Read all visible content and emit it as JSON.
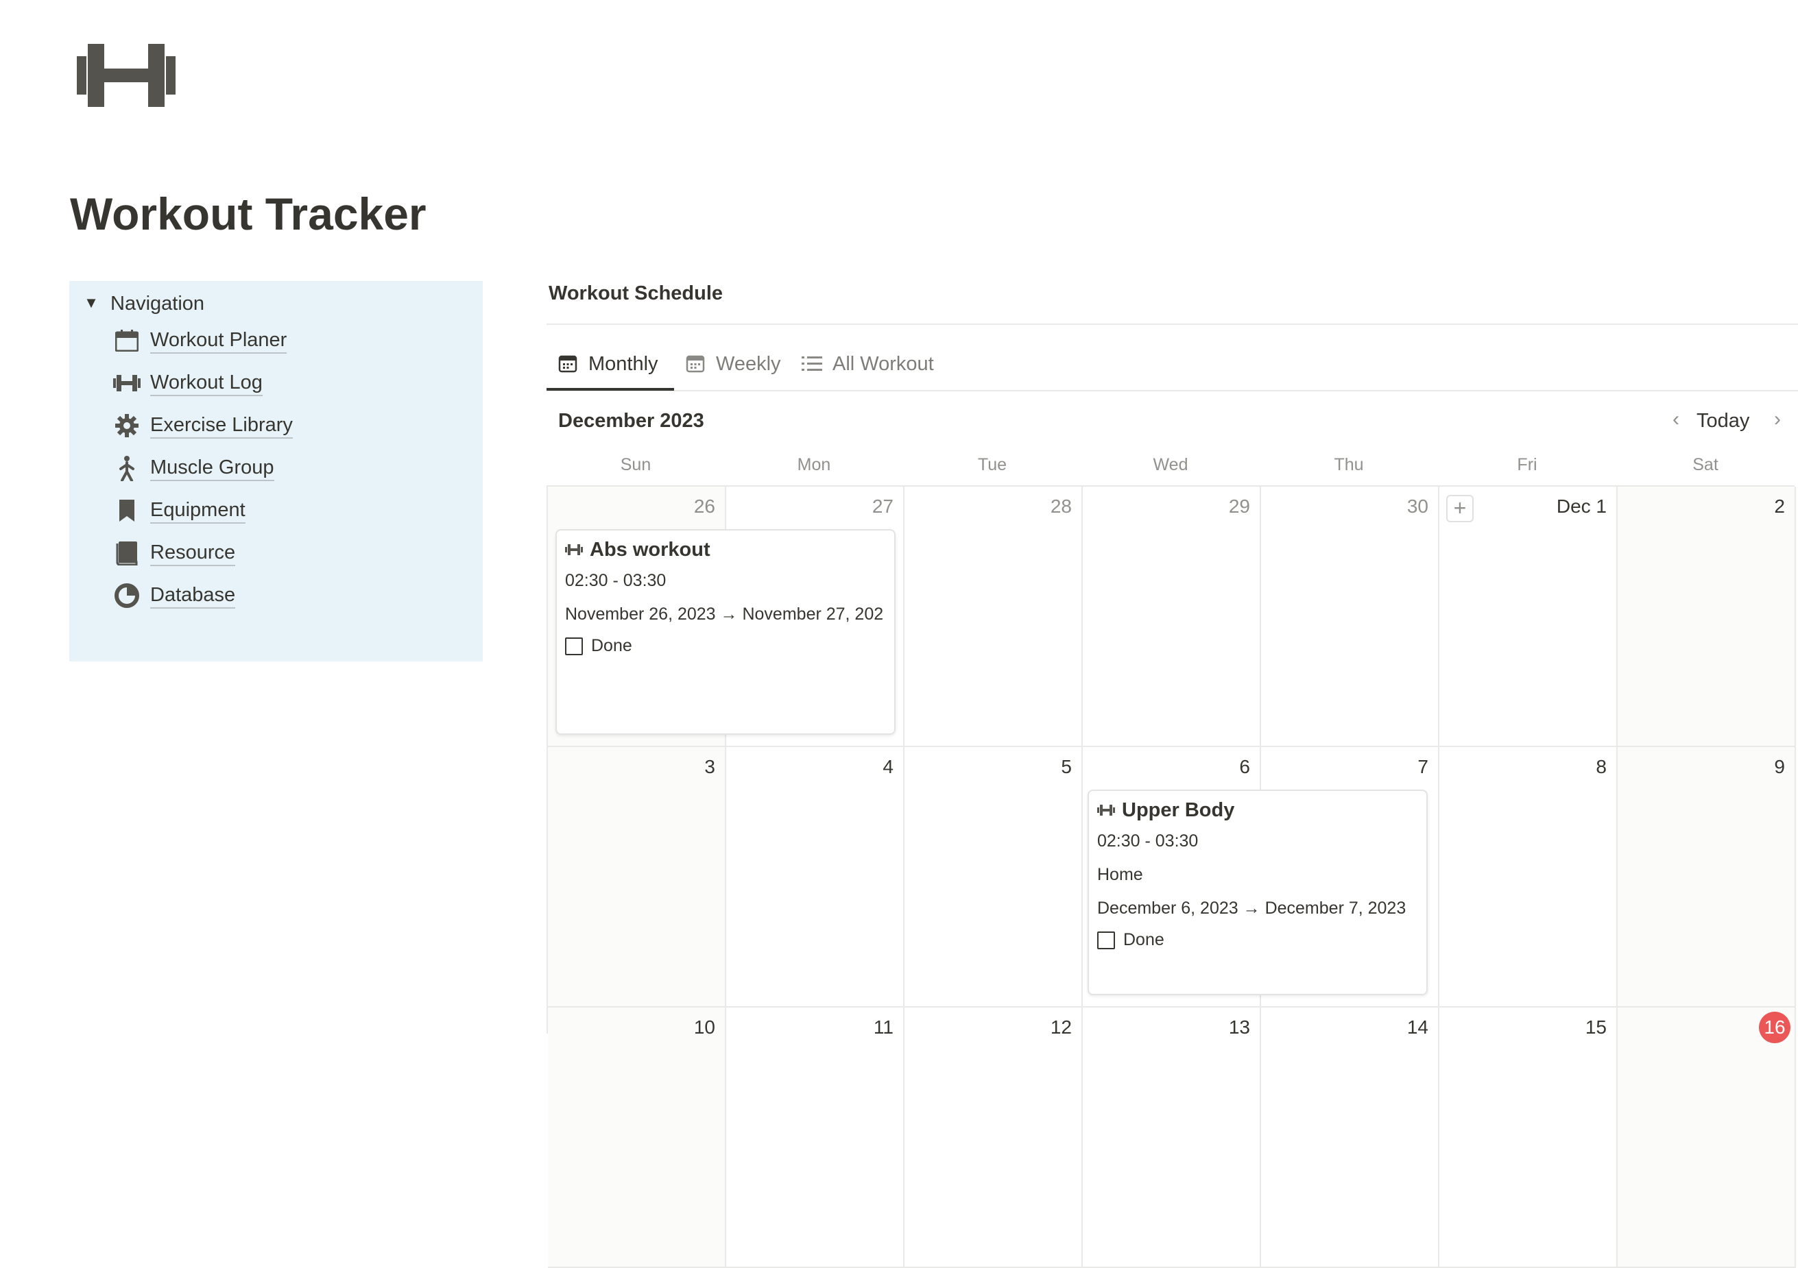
{
  "page": {
    "title": "Workout Tracker",
    "icon": "dumbbell-icon"
  },
  "navigation": {
    "title": "Navigation",
    "background": "#e7f3f8",
    "items": [
      {
        "label": "Workout Planer",
        "icon": "calendar-icon"
      },
      {
        "label": "Workout Log",
        "icon": "dumbbell-icon"
      },
      {
        "label": "Exercise Library",
        "icon": "gear-icon"
      },
      {
        "label": "Muscle Group",
        "icon": "person-walking-icon"
      },
      {
        "label": "Equipment",
        "icon": "bookmark-icon"
      },
      {
        "label": "Resource",
        "icon": "book-icon"
      },
      {
        "label": "Database",
        "icon": "pie-chart-icon"
      }
    ]
  },
  "schedule": {
    "title": "Workout Schedule",
    "tabs": [
      {
        "label": "Monthly",
        "icon": "calendar-view-icon",
        "active": true
      },
      {
        "label": "Weekly",
        "icon": "calendar-view-icon",
        "active": false
      },
      {
        "label": "All Workout",
        "icon": "list-icon",
        "active": false
      }
    ],
    "calendar": {
      "month": "December 2023",
      "today_label": "Today",
      "weekdays": [
        "Sun",
        "Mon",
        "Tue",
        "Wed",
        "Thu",
        "Fri",
        "Sat"
      ],
      "today_color": "#eb5757",
      "weeks": [
        [
          "26",
          "27",
          "28",
          "29",
          "30",
          "Dec 1",
          "2"
        ],
        [
          "3",
          "4",
          "5",
          "6",
          "7",
          "8",
          "9"
        ],
        [
          "10",
          "11",
          "12",
          "13",
          "14",
          "15",
          "16"
        ]
      ],
      "events": [
        {
          "title": "Abs workout",
          "icon": "dumbbell-icon",
          "time": "02:30 - 03:30",
          "dates": "November 26, 2023 → November 27, 202",
          "done_label": "Done",
          "done": false
        },
        {
          "title": "Upper Body",
          "icon": "dumbbell-icon",
          "time": "02:30 - 03:30",
          "location": "Home",
          "dates": "December 6, 2023 → December 7, 2023",
          "done_label": "Done",
          "done": false
        }
      ]
    }
  }
}
